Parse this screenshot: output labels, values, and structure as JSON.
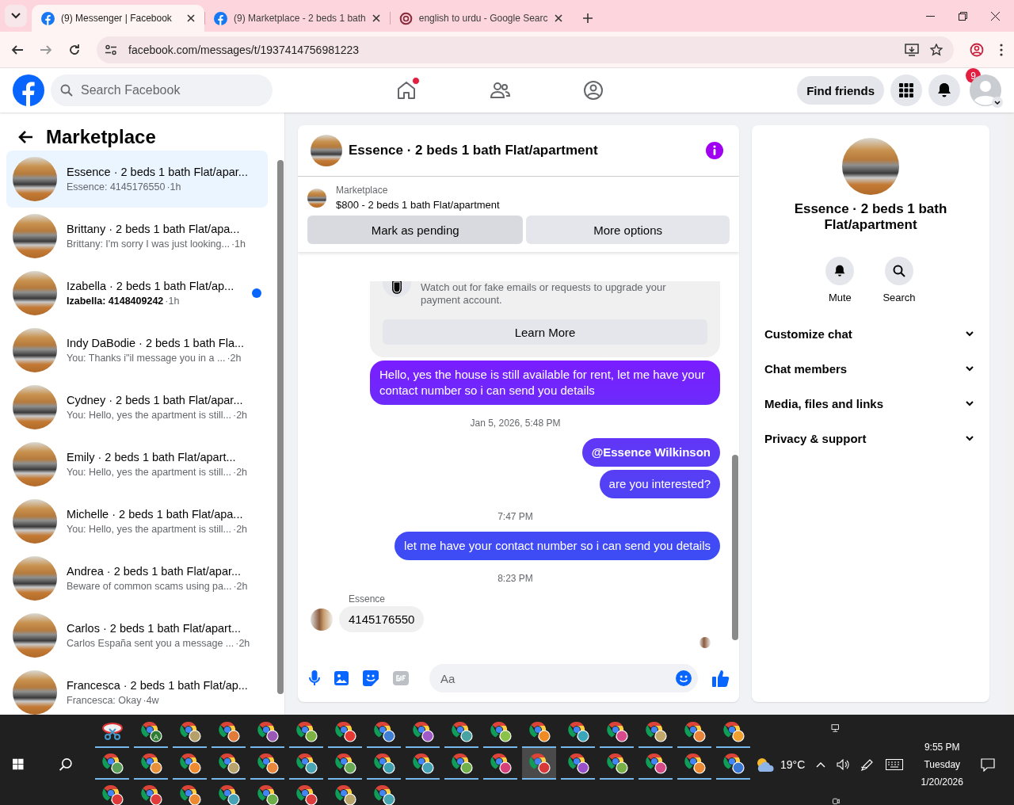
{
  "browser": {
    "tabs": [
      {
        "title": "(9) Messenger | Facebook",
        "kind": "facebook",
        "selected": true
      },
      {
        "title": "(9) Marketplace - 2 beds 1 bath",
        "kind": "facebook",
        "selected": false
      },
      {
        "title": "english to urdu - Google Searc",
        "kind": "search",
        "selected": false
      }
    ],
    "url": "facebook.com/messages/t/1937414756981223"
  },
  "header": {
    "search_placeholder": "Search Facebook",
    "nav": [
      {
        "kind": "home",
        "dot": true
      },
      {
        "kind": "friends",
        "dot": false
      },
      {
        "kind": "groups",
        "dot": false
      }
    ],
    "find_friends": "Find friends",
    "notification_count": "9"
  },
  "sidebar": {
    "title": "Marketplace",
    "conversations": [
      {
        "title": "Essence · 2 beds 1 bath Flat/apar...",
        "preview": "Essence: 4145176550",
        "time": "·1h",
        "selected": true,
        "unread": false
      },
      {
        "title": "Brittany · 2 beds 1 bath Flat/apa...",
        "preview": "Brittany: I'm sorry I was just looking...",
        "time": "·1h",
        "selected": false,
        "unread": false
      },
      {
        "title": "Izabella · 2 beds 1 bath Flat/ap...",
        "preview": "Izabella: 4148409242",
        "time": "·1h",
        "selected": false,
        "unread": true
      },
      {
        "title": "Indy DaBodie · 2 beds 1 bath Fla...",
        "preview": "You: Thanks i\"il message you in a ...",
        "time": "·2h",
        "selected": false,
        "unread": false
      },
      {
        "title": "Cydney · 2 beds 1 bath Flat/apar...",
        "preview": "You: Hello, yes the apartment is still...",
        "time": "·2h",
        "selected": false,
        "unread": false
      },
      {
        "title": "Emily · 2 beds 1 bath Flat/apart...",
        "preview": "You: Hello, yes the apartment is still...",
        "time": "·2h",
        "selected": false,
        "unread": false
      },
      {
        "title": "Michelle · 2 beds 1 bath Flat/apa...",
        "preview": "You: Hello, yes the apartment is still...",
        "time": "·2h",
        "selected": false,
        "unread": false
      },
      {
        "title": "Andrea · 2 beds 1 bath Flat/apar...",
        "preview": "Beware of common scams using pa...",
        "time": "·2h",
        "selected": false,
        "unread": false
      },
      {
        "title": "Carlos · 2 beds 1 bath Flat/apart...",
        "preview": "Carlos España sent you a message ...",
        "time": "·2h",
        "selected": false,
        "unread": false
      },
      {
        "title": "Francesca · 2 beds 1 bath Flat/ap...",
        "preview": "Francesca: Okay",
        "time": "·4w",
        "selected": false,
        "unread": false
      }
    ]
  },
  "chat": {
    "title": "Essence · 2 beds 1 bath Flat/apartment",
    "listing": {
      "label": "Marketplace",
      "price_line": "$800 - 2 beds 1 bath Flat/apartment",
      "buttons": [
        {
          "label": "Mark as pending",
          "selected": true
        },
        {
          "label": "More options",
          "selected": false
        }
      ]
    },
    "messages": [
      {
        "kind": "notice",
        "text": "Watch out for fake emails or requests to upgrade your payment account.",
        "button": "Learn More"
      },
      {
        "kind": "outgoing",
        "text": "Hello, yes the house is still available for rent, let me have your contact number so i can send you details",
        "mention": false
      },
      {
        "kind": "timestamp",
        "text": "Jan 5, 2026, 5:48 PM"
      },
      {
        "kind": "outgoing",
        "text": "@Essence Wilkinson",
        "mention": true
      },
      {
        "kind": "outgoing",
        "text": "are you interested?",
        "mention": false
      },
      {
        "kind": "timestamp",
        "text": "7:47 PM"
      },
      {
        "kind": "outgoing",
        "text": "let me have your contact number so i can send you details",
        "mention": false
      },
      {
        "kind": "timestamp",
        "text": "8:23 PM"
      },
      {
        "kind": "incoming",
        "sender": "Essence",
        "text": "4145176550"
      }
    ],
    "composer_placeholder": "Aa"
  },
  "details": {
    "title": "Essence · 2 beds 1 bath Flat/apartment",
    "actions": [
      {
        "kind": "mute",
        "label": "Mute"
      },
      {
        "kind": "search",
        "label": "Search"
      }
    ],
    "sections": [
      {
        "label": "Customize chat",
        "expanded": false
      },
      {
        "label": "Chat members",
        "expanded": false
      },
      {
        "label": "Media, files and links",
        "expanded": false
      },
      {
        "label": "Privacy & support",
        "expanded": false
      }
    ]
  },
  "taskbar": {
    "apps": [
      {
        "kind": "tool",
        "selected": false
      },
      {
        "kind": "browser",
        "color": "#2e7d32",
        "badge": "A",
        "selected": false
      },
      {
        "kind": "browser",
        "color": "#b5a06a",
        "selected": false
      },
      {
        "kind": "browser",
        "color": "#e07b39",
        "selected": false
      },
      {
        "kind": "browser",
        "color": "#9b59b6",
        "selected": false
      },
      {
        "kind": "browser",
        "color": "#7cb342",
        "selected": false
      },
      {
        "kind": "browser",
        "color": "#e53935",
        "selected": false
      },
      {
        "kind": "browser",
        "color": "#3f7fd6",
        "selected": false
      },
      {
        "kind": "browser",
        "color": "#a05ac8",
        "selected": false
      },
      {
        "kind": "browser",
        "color": "#4aa3a3",
        "selected": false
      },
      {
        "kind": "browser",
        "color": "#8bc34a",
        "selected": false
      },
      {
        "kind": "browser",
        "color": "#f08a24",
        "selected": false
      },
      {
        "kind": "browser",
        "color": "#3aa6b9",
        "selected": false
      },
      {
        "kind": "browser",
        "color": "#d94a8c",
        "selected": false
      },
      {
        "kind": "browser",
        "color": "#c2a86a",
        "selected": false
      },
      {
        "kind": "browser",
        "color": "#e8833a",
        "selected": false
      },
      {
        "kind": "browser",
        "color": "#f0a030",
        "selected": false
      },
      {
        "kind": "browser",
        "color": "#5aa05a",
        "selected": false
      },
      {
        "kind": "browser",
        "color": "#e8913a",
        "selected": false
      },
      {
        "kind": "browser",
        "color": "#ee8a30",
        "selected": false
      },
      {
        "kind": "browser",
        "color": "#b8a46c",
        "selected": false
      },
      {
        "kind": "browser",
        "color": "#e9873c",
        "selected": false
      },
      {
        "kind": "browser",
        "color": "#4aa5b5",
        "selected": false
      },
      {
        "kind": "browser",
        "color": "#66aa55",
        "selected": false
      },
      {
        "kind": "browser",
        "color": "#3fa0b0",
        "selected": false
      },
      {
        "kind": "browser",
        "color": "#45a2b4",
        "selected": false
      },
      {
        "kind": "browser",
        "color": "#6fb04a",
        "selected": false
      },
      {
        "kind": "browser",
        "color": "#d6417a",
        "selected": false
      },
      {
        "kind": "browser",
        "color": "#d93838",
        "selected": true
      },
      {
        "kind": "browser",
        "color": "#9a50c8",
        "selected": false
      },
      {
        "kind": "browser",
        "color": "#78b048",
        "selected": false
      },
      {
        "kind": "browser",
        "color": "#d64a88",
        "selected": false
      },
      {
        "kind": "browser",
        "color": "#eb8a32",
        "selected": false
      },
      {
        "kind": "browser",
        "color": "#3b78d4",
        "selected": false
      },
      {
        "kind": "browser",
        "color": "#dd3a3a",
        "selected": false
      },
      {
        "kind": "browser",
        "color": "#e03c3c",
        "selected": false
      },
      {
        "kind": "browser",
        "color": "#ec8a34",
        "selected": false
      },
      {
        "kind": "browser",
        "color": "#46a4b6",
        "selected": false
      },
      {
        "kind": "browser",
        "color": "#6cae48",
        "selected": false
      },
      {
        "kind": "browser",
        "color": "#df3e3e",
        "selected": false
      },
      {
        "kind": "browser",
        "color": "#baa66a",
        "selected": false
      },
      {
        "kind": "browser",
        "color": "#48a6b2",
        "selected": false
      }
    ],
    "temperature": "19°C",
    "time": "9:55 PM",
    "day": "Tuesday",
    "date": "1/20/2026"
  }
}
